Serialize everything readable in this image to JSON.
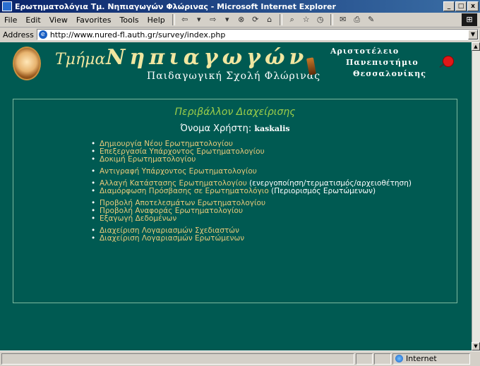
{
  "window": {
    "title": "Ερωτηματολόγια Τμ. Νηπιαγωγών Φλώρινας - Microsoft Internet Explorer",
    "buttons": [
      "_",
      "□",
      "x"
    ]
  },
  "menubar": {
    "items": [
      "File",
      "Edit",
      "View",
      "Favorites",
      "Tools",
      "Help"
    ]
  },
  "addressbar": {
    "label": "Address",
    "url": "http://www.nured-fl.auth.gr/survey/index.php"
  },
  "header": {
    "script_word": "Τμήμα",
    "big_word": "Νηπιαγωγών",
    "subtitle": "Παιδαγωγική Σχολή Φλώρινας",
    "university_line1": "Αριστοτέλειο",
    "university_line2": "Πανεπιστήμιο",
    "university_line3": "Θεσσαλονίκης"
  },
  "content": {
    "title": "Περιβάλλον Διαχείρισης",
    "user_label": "Όνομα Χρήστη: ",
    "username": "kaskalis",
    "groups": [
      [
        "Δημιουργία Νέου Ερωτηματολογίου",
        "Επεξεργασία Υπάρχοντος Ερωτηματολογίου",
        "Δοκιμή Ερωτηματολογίου"
      ],
      [
        "Αντιγραφή Υπάρχοντος Ερωτηματολογίου"
      ],
      [
        {
          "text": "Αλλαγή Κατάστασης Ερωτηματολογίου",
          "note": " (ενεργοποίηση/τερματισμός/αρχειοθέτηση)"
        },
        {
          "text": "Διαμόρφωση Πρόσβασης σε Ερωτηματολόγιο",
          "note": " (Περιορισμός Ερωτώμενων)"
        }
      ],
      [
        "Προβολή Αποτελεσμάτων Ερωτηματολογίου",
        "Προβολή Αναφοράς Ερωτηματολογίου",
        "Εξαγωγή Δεδομένων"
      ],
      [
        "Διαχείριση Λογαριασμών Σχεδιαστών",
        "Διαχείριση Λογαριασμών Ερωτώμενων"
      ]
    ]
  },
  "statusbar": {
    "zone": "Internet"
  },
  "colors": {
    "page_bg": "#005a52",
    "link": "#e7c97a",
    "title": "#9ccd4a"
  }
}
